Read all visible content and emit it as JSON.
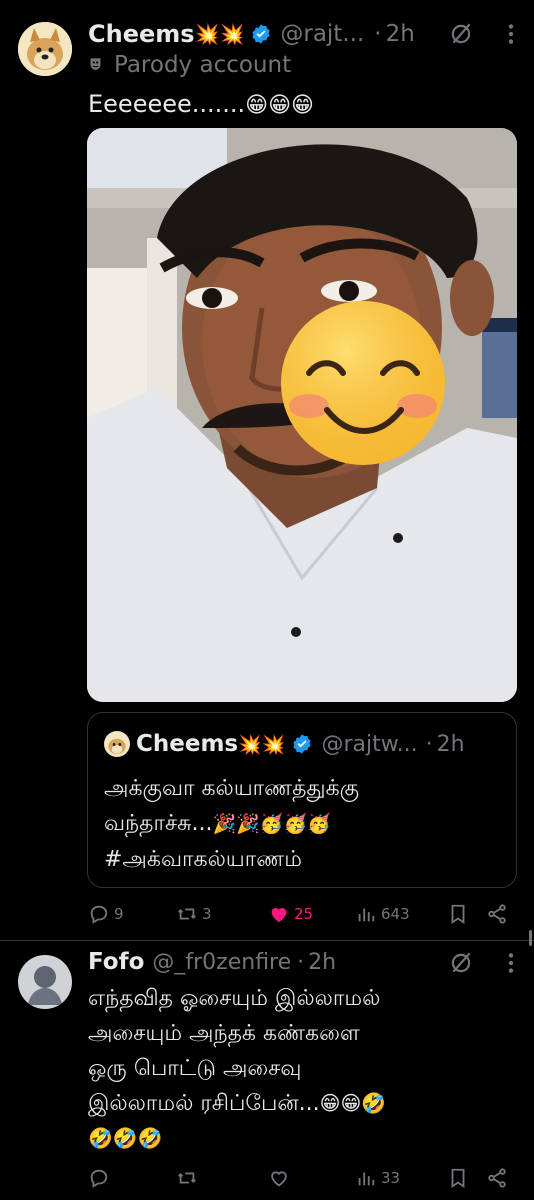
{
  "tweet1": {
    "name": "Cheems",
    "name_emojis": "💥💥",
    "handle": "@rajt...",
    "dot": "·",
    "time": "2h",
    "parody_label": "Parody account",
    "text": "Eeeeeee.......",
    "text_emojis": "😁😁😁",
    "media_alt": "Photo of a man in a white shirt with a smiling emoji covering part of his face",
    "quote": {
      "name": "Cheems",
      "name_emojis": "💥💥",
      "handle": "@rajtw...",
      "dot": "·",
      "time": "2h",
      "line1": "அக்குவா கல்யாணத்துக்கு",
      "line2": "வந்தாச்சு...",
      "line2_emojis": "🎉🎉🥳🥳🥳",
      "line3": "#அக்வாகல்யாணம்"
    },
    "stats": {
      "replies": "9",
      "reposts": "3",
      "likes": "25",
      "views": "643"
    }
  },
  "tweet2": {
    "name": "Fofo",
    "handle": "@_fr0zenfire",
    "dot": "·",
    "time": "2h",
    "line1": "எந்தவித ஓசையும் இல்லாமல்",
    "line2": "அசையும் அந்தக் கண்களை",
    "line3": "ஒரு பொட்டு அசைவு",
    "line4": "இல்லாமல் ரசிப்பேன்...",
    "line4_emojis": "😁😁🤣",
    "line5_emojis": "🤣🤣🤣",
    "stats": {
      "replies": "",
      "reposts": "",
      "likes": "",
      "views": "33"
    }
  },
  "colors": {
    "background": "#000000",
    "text": "#e7e9ea",
    "muted": "#71767b",
    "verified": "#1d9bf0",
    "like": "#f91880",
    "divider": "#2f3336"
  }
}
